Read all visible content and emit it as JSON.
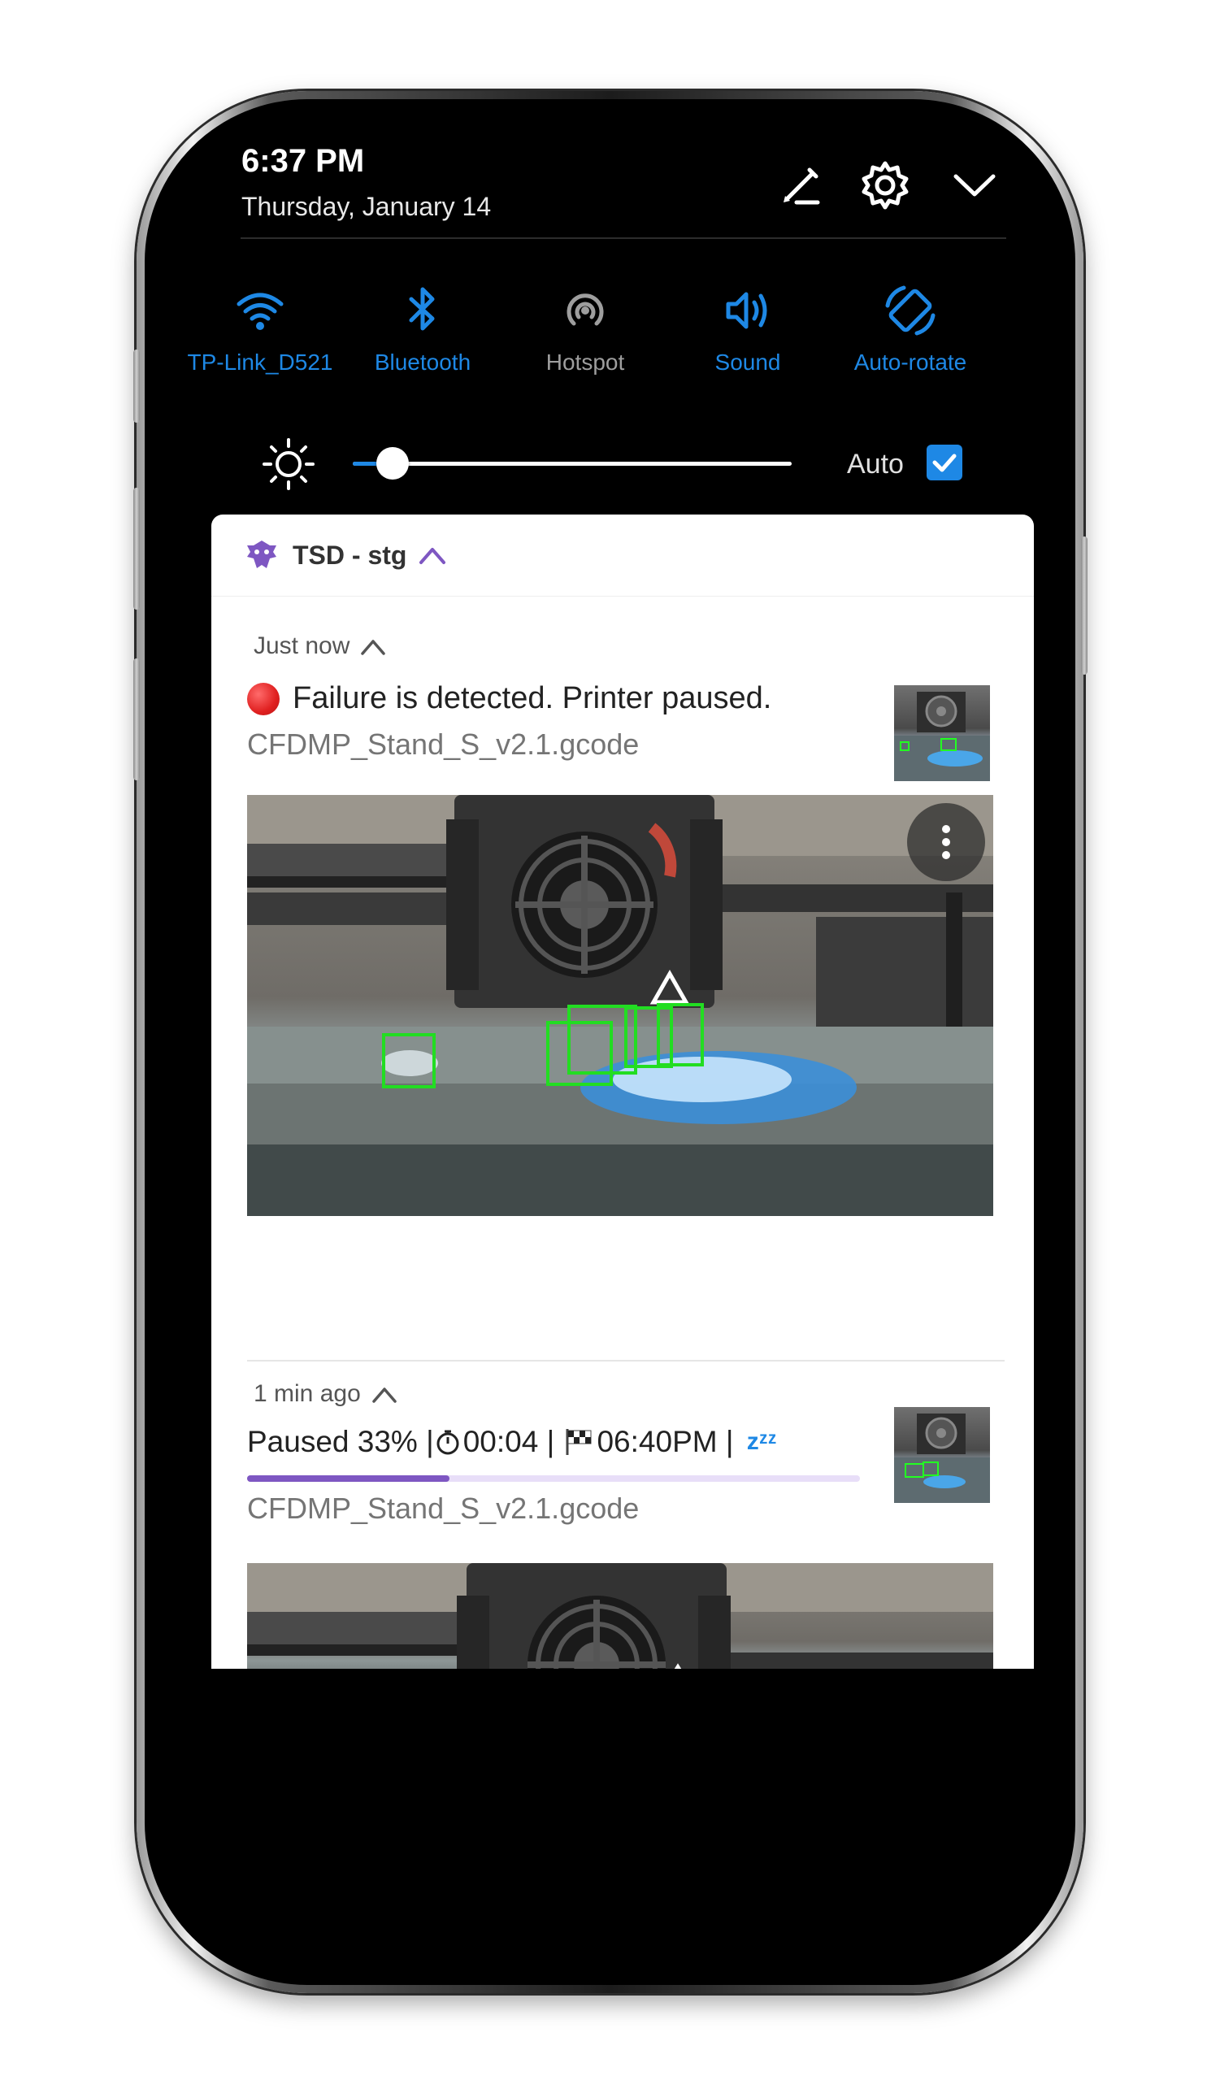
{
  "status": {
    "time": "6:37 PM",
    "date": "Thursday, January 14"
  },
  "header_icons": [
    "edit-icon",
    "settings-gear-icon",
    "chevron-down-icon"
  ],
  "quick_toggles": [
    {
      "label": "TP-Link_D521",
      "icon": "wifi-icon",
      "active": true
    },
    {
      "label": "Bluetooth",
      "icon": "bluetooth-icon",
      "active": true
    },
    {
      "label": "Hotspot",
      "icon": "hotspot-icon",
      "active": false
    },
    {
      "label": "Sound",
      "icon": "sound-icon",
      "active": true
    },
    {
      "label": "Auto-rotate",
      "icon": "auto-rotate-icon",
      "active": true
    }
  ],
  "brightness": {
    "level": 0.09,
    "auto_label": "Auto",
    "auto_checked": true
  },
  "notification_group": {
    "app_name": "TSD - stg",
    "notifications": [
      {
        "time": "Just now",
        "title": "Failure is detected. Printer paused.",
        "file": "CFDMP_Stand_S_v2.1.gcode"
      },
      {
        "time": "1 min ago",
        "status_text": "Paused 33% | ",
        "elapsed": "00:04",
        "eta": "06:40PM",
        "sleep_glyph": "zᶻᶻ",
        "progress": 0.33,
        "file": "CFDMP_Stand_S_v2.1.gcode"
      }
    ]
  },
  "colors": {
    "accent_blue": "#1e88e5",
    "inactive_gray": "#9e9e9e",
    "app_purple": "#7e57c2",
    "alert_red": "#e02020",
    "detection_green": "#22dd22"
  }
}
